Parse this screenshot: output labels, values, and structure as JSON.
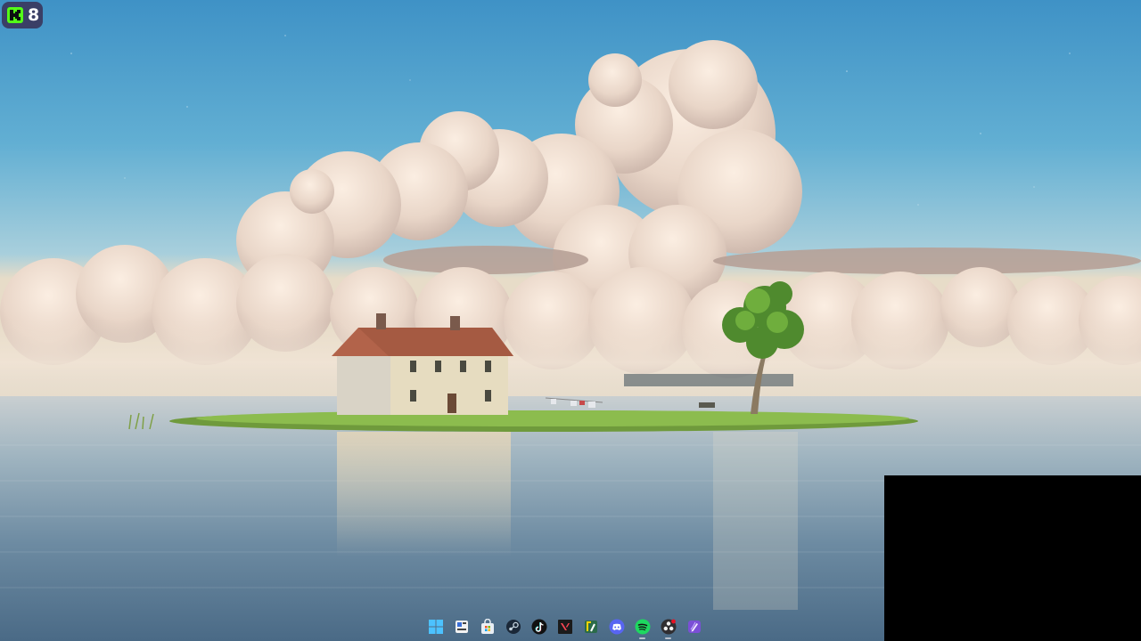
{
  "badge": {
    "count": "8",
    "icon": "kick-logo-icon",
    "color": "#53fc18"
  },
  "taskbar": {
    "items": [
      {
        "name": "start-icon",
        "active": false
      },
      {
        "name": "task-view-icon",
        "active": false
      },
      {
        "name": "store-icon",
        "active": false
      },
      {
        "name": "steam-icon",
        "active": false
      },
      {
        "name": "tiktok-icon",
        "active": false
      },
      {
        "name": "valorant-icon",
        "active": false
      },
      {
        "name": "notion-tool-icon",
        "active": false
      },
      {
        "name": "discord-icon",
        "active": false
      },
      {
        "name": "spotify-icon",
        "active": true
      },
      {
        "name": "obs-icon",
        "active": true
      },
      {
        "name": "pen-app-icon",
        "active": false
      }
    ]
  }
}
